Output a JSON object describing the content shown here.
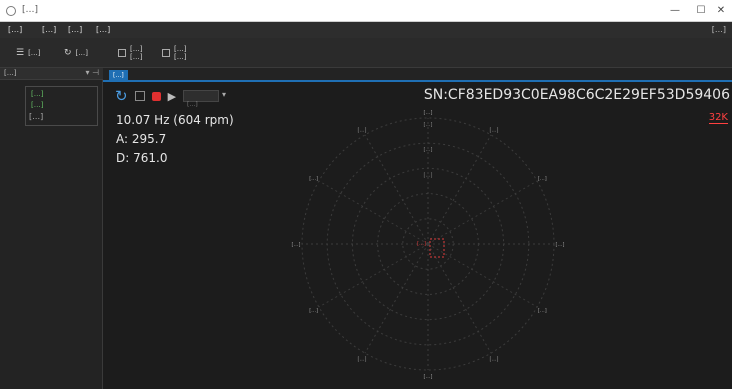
{
  "window": {
    "title": "[…]",
    "minimize": "—",
    "maximize": "☐",
    "close": "✕"
  },
  "menu": {
    "items": [
      "[…]",
      "[…]",
      "[…]",
      "[…]"
    ],
    "account": "[…]"
  },
  "toolbar": {
    "listen": {
      "icon": "menu-icon",
      "label": "[…]"
    },
    "refresh": {
      "icon": "refresh-icon",
      "label": "[…]"
    },
    "map_editor": {
      "line1": "[…]",
      "line2": "[…]"
    },
    "multi_phase": {
      "line1": "[…]",
      "line2": "[…]"
    }
  },
  "sidebar": {
    "title": "[…]",
    "device": {
      "line1": "[…]",
      "line2": "[…]",
      "icons": "[…]"
    }
  },
  "tabs": [
    {
      "label": "[…]"
    }
  ],
  "controls": {
    "dropdown": "[…]"
  },
  "readout": {
    "serial": "SN:CF83ED93C0EA98C6C2E29EF53D59406",
    "rate": "32K",
    "frequency": "10.07 Hz (604 rpm)",
    "amplitude": "A: 295.7",
    "direction": "D: 761.0"
  },
  "polar": {
    "angle_labels": [
      "[…]",
      "[…]",
      "[…]",
      "[…]",
      "[…]",
      "[…]",
      "[…]",
      "[…]",
      "[…]",
      "[…]",
      "[…]",
      "[…]"
    ],
    "ring_labels": [
      "[…]",
      "[…]",
      "[…]"
    ],
    "center_label": "[…]",
    "grid_color": "#3c3c3c",
    "marker_color": "#e03c3c"
  },
  "colors": {
    "accent": "#1f6fb4",
    "status_green": "#66c466",
    "alert_red": "#ff4040"
  }
}
